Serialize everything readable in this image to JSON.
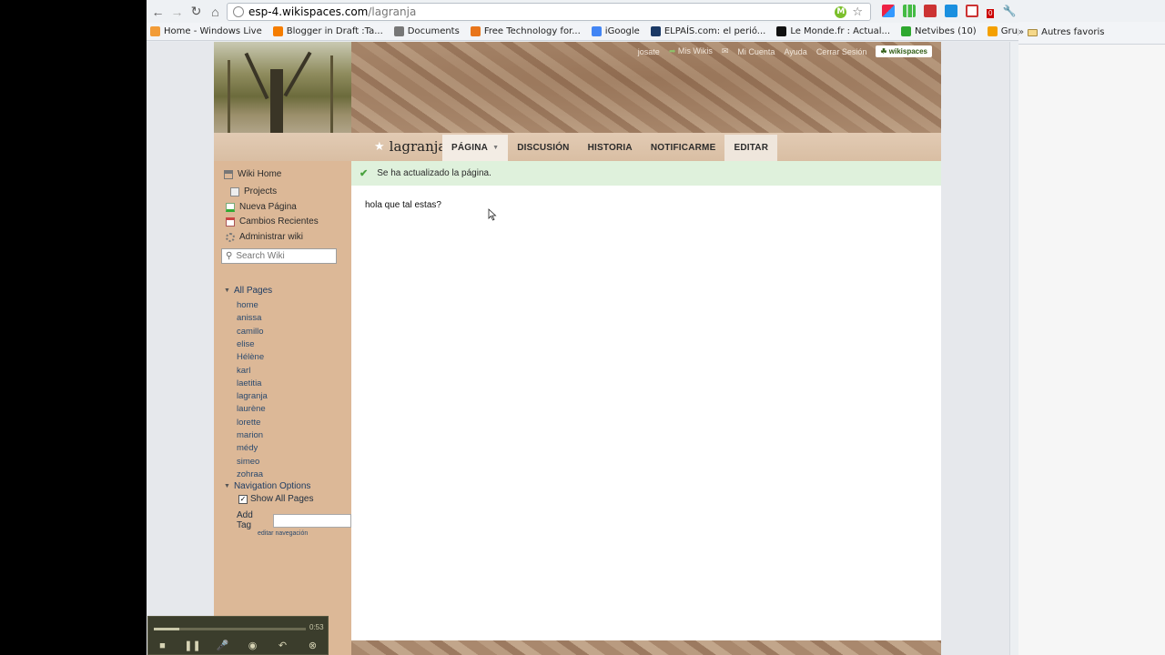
{
  "browser": {
    "url_host": "esp-4.wikispaces.com",
    "url_path": "/lagranja",
    "bookmarks": [
      {
        "label": "Home - Windows Live",
        "color": "#f29c38"
      },
      {
        "label": "Blogger in Draft :Ta...",
        "color": "#f57d00"
      },
      {
        "label": "Documents",
        "color": "#777777"
      },
      {
        "label": "Free Technology for...",
        "color": "#e8751a"
      },
      {
        "label": "iGoogle",
        "color": "#4285f4"
      },
      {
        "label": "ELPAÍS.com: el perió...",
        "color": "#1c3a66"
      },
      {
        "label": "Le Monde.fr : Actual...",
        "color": "#111111"
      },
      {
        "label": "Netvibes (10)",
        "color": "#2fa82f"
      },
      {
        "label": "Grupo RTVE",
        "color": "#f4a000"
      }
    ],
    "bookmarks_other": "Autres favoris",
    "mail_badge": "0"
  },
  "wiki": {
    "user_nav": {
      "user": "josate",
      "my_wikis": "Mis Wikis",
      "account": "Mi Cuenta",
      "help": "Ayuda",
      "logout": "Cerrar Sesión",
      "brand": "wikispaces"
    },
    "page_title": "lagranja",
    "tabs": {
      "page": "PÁGINA",
      "discussion": "DISCUSIÓN",
      "history": "HISTORIA",
      "notify": "NOTIFICARME",
      "edit": "EDITAR"
    },
    "sidebar": {
      "wiki_home": "Wiki Home",
      "projects": "Projects",
      "new_page": "Nueva Página",
      "recent_changes": "Cambios Recientes",
      "manage": "Administrar wiki",
      "search_placeholder": "Search Wiki",
      "all_pages_title": "All Pages",
      "pages": [
        "home",
        "anissa",
        "camillo",
        "elise",
        "Hélène",
        "karl",
        "laetitia",
        "lagranja",
        "laurène",
        "lorette",
        "marion",
        "médy",
        "simeo",
        "zohraa"
      ],
      "nav_options_title": "Navigation Options",
      "show_all_pages": "Show All Pages",
      "add_tag": "Add Tag",
      "edit_nav": "editar navegación"
    },
    "notice": "Se ha actualizado la página.",
    "body_text": "hola que tal estas?"
  },
  "media_player": {
    "time": "0:53",
    "progress": 0.17
  }
}
